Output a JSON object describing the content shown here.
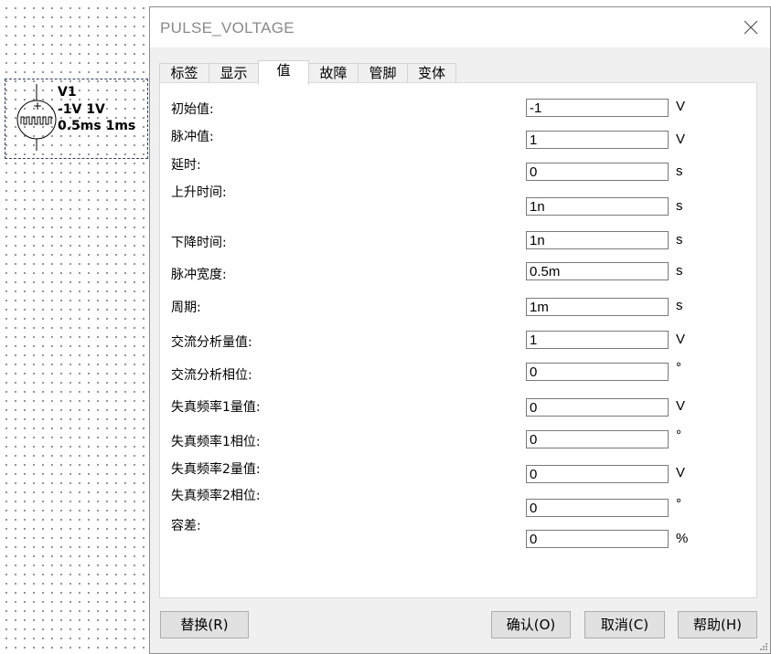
{
  "component": {
    "name": "V1",
    "amplitude": "-1V 1V",
    "timing": "0.5ms 1ms",
    "border_color": "#2b3a8a"
  },
  "dialog": {
    "title": "PULSE_VOLTAGE",
    "close_icon": "close-icon",
    "tabs": [
      {
        "label": "标签"
      },
      {
        "label": "显示"
      },
      {
        "label": "值",
        "active": true
      },
      {
        "label": "故障"
      },
      {
        "label": "管脚"
      },
      {
        "label": "变体"
      }
    ],
    "params": [
      {
        "label": "初始值:",
        "value": "-1",
        "unit": "V"
      },
      {
        "label": "脉冲值:",
        "value": "1",
        "unit": "V"
      },
      {
        "label": "延时:",
        "value": "0",
        "unit": "s"
      },
      {
        "label": "上升时间:",
        "value": "1n",
        "unit": "s"
      },
      {
        "label": "下降时间:",
        "value": "1n",
        "unit": "s"
      },
      {
        "label": "脉冲宽度:",
        "value": "0.5m",
        "unit": "s"
      },
      {
        "label": "周期:",
        "value": "1m",
        "unit": "s"
      },
      {
        "label": "交流分析量值:",
        "value": "1",
        "unit": "V"
      },
      {
        "label": "交流分析相位:",
        "value": "0",
        "unit": "°"
      },
      {
        "label": "失真频率1量值:",
        "value": "0",
        "unit": "V"
      },
      {
        "label": "失真频率1相位:",
        "value": "0",
        "unit": "°"
      },
      {
        "label": "失真频率2量值:",
        "value": "0",
        "unit": "V"
      },
      {
        "label": "失真频率2相位:",
        "value": "0",
        "unit": "°"
      },
      {
        "label": "容差:",
        "value": "0",
        "unit": "%"
      }
    ],
    "buttons": {
      "replace": "替换(R)",
      "ok": "确认(O)",
      "cancel": "取消(C)",
      "help": "帮助(H)"
    }
  }
}
